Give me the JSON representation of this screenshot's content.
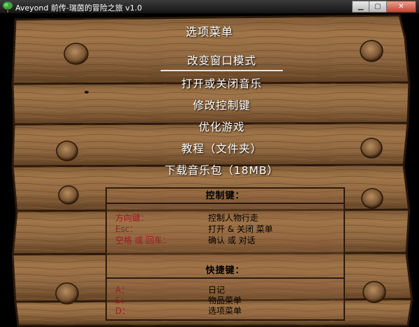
{
  "window": {
    "title": "Aveyond 前传-瑞茵的冒险之旅 v1.0",
    "minimize_glyph": "▁",
    "maximize_glyph": "▢",
    "close_glyph": "✕"
  },
  "menu": {
    "title": "选项菜单",
    "items": [
      {
        "label": "改变窗口模式",
        "selected": true
      },
      {
        "label": "打开或关闭音乐",
        "selected": false
      },
      {
        "label": "修改控制键",
        "selected": false
      },
      {
        "label": "优化游戏",
        "selected": false
      },
      {
        "label": "教程（文件夹）",
        "selected": false
      },
      {
        "label": "下载音乐包（18MB）",
        "selected": false
      }
    ]
  },
  "controls": {
    "heading": "控制键：",
    "rows": [
      {
        "key": "方向键：",
        "value": "控制人物行走"
      },
      {
        "key": "Esc：",
        "value": "打开 & 关闭 菜单"
      },
      {
        "key": "空格 或 回车：",
        "value": "确认 或 对话"
      }
    ]
  },
  "shortcuts": {
    "heading": "快捷键：",
    "rows": [
      {
        "key": "A：",
        "value": "日记"
      },
      {
        "key": "S：",
        "value": "物品菜单"
      },
      {
        "key": "D：",
        "value": "选项菜单"
      }
    ]
  },
  "colors": {
    "wood_light": "#9a6f45",
    "wood_dark": "#4a2e17",
    "key_text": "#a0182a",
    "menu_text": "#ffffff"
  },
  "icons": [
    "tree-icon",
    "minimize-icon",
    "maximize-icon",
    "close-icon",
    "wood-knot-icon"
  ]
}
